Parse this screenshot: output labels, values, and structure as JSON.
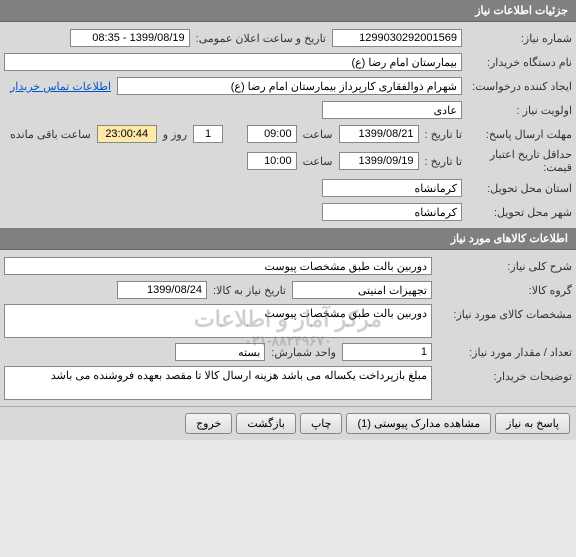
{
  "section1": {
    "title": "جزئیات اطلاعات نیاز",
    "fields": {
      "need_no_label": "شماره نیاز:",
      "need_no": "1299030292001569",
      "announce_label": "تاریخ و ساعت اعلان عمومی:",
      "announce_value": "1399/08/19 - 08:35",
      "buyer_org_label": "نام دستگاه خریدار:",
      "buyer_org": "بیمارستان امام رضا (ع)",
      "creator_label": "ایجاد کننده درخواست:",
      "creator": "شهرام ذوالفقاری کارپرداز بیمارستان امام رضا (ع)",
      "contact_link": "اطلاعات تماس خریدار",
      "priority_label": "اولویت نیاز :",
      "priority": "عادی",
      "deadline_label": "مهلت ارسال پاسخ:",
      "deadline_sub1": "تا تاریخ :",
      "deadline_date": "1399/08/21",
      "time_label": "ساعت",
      "deadline_time": "09:00",
      "remain_days": "1",
      "remain_days_label": "روز و",
      "remain_time": "23:00:44",
      "remain_suffix": "ساعت باقی مانده",
      "min_credit_label": "حداقل تاریخ اعتبار قیمت:",
      "min_credit_sub": "تا تاریخ :",
      "min_credit_date": "1399/09/19",
      "min_credit_time": "10:00",
      "province_label": "استان محل تحویل:",
      "province": "کرمانشاه",
      "city_label": "شهر محل تحویل:",
      "city": "کرمانشاه"
    }
  },
  "section2": {
    "title": "اطلاعات کالاهای مورد نیاز",
    "fields": {
      "desc_label": "شرح کلی نیاز:",
      "desc": "دوربین بالت طبق مشخصات پیوست",
      "group_label": "گروه کالا:",
      "group": "تجهیزات امنیتی",
      "need_date_label": "تاریخ نیاز به کالا:",
      "need_date": "1399/08/24",
      "spec_label": "مشخصات کالای مورد نیاز:",
      "spec": "دوربین بالت طبق مشخصات پیوست",
      "qty_label": "تعداد / مقدار مورد نیاز:",
      "qty": "1",
      "unit_label": "واحد شمارش:",
      "unit": "بسته",
      "notes_label": "توضیحات خریدار:",
      "notes": "مبلغ بازپرداخت یکساله می باشد هزینه ارسال کالا تا مقصد بعهده فروشنده می باشد"
    },
    "watermark_main": "مرکز آمار و اطلاعات",
    "watermark_sub": "۰۲۱-۸۸۲۴۹۶۷۰"
  },
  "buttons": {
    "respond": "پاسخ به نیاز",
    "attachments": "مشاهده مدارک پیوستی (1)",
    "print": "چاپ",
    "back": "بازگشت",
    "exit": "خروج"
  }
}
